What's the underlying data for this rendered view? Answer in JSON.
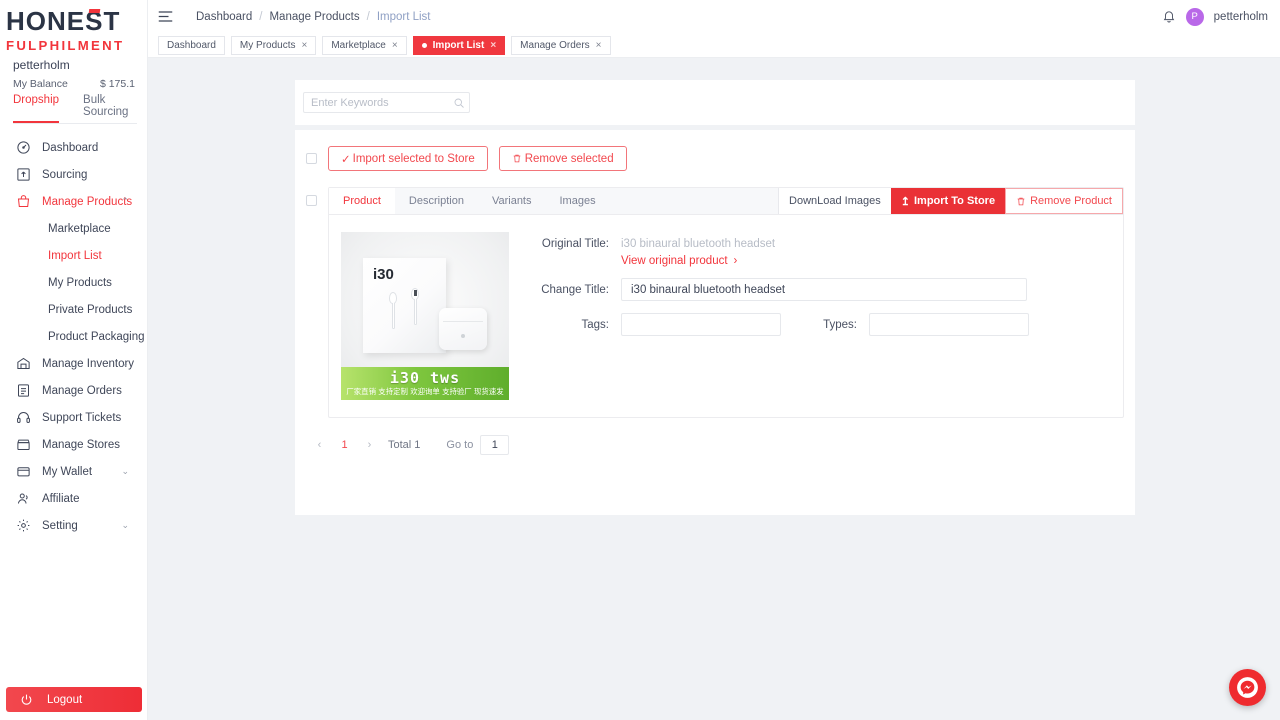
{
  "brand": {
    "logo_top": "HONEST",
    "logo_bottom": "FULPHILMENT",
    "accent_red": "#f2353c",
    "navy": "#2b3445"
  },
  "sidebar": {
    "username": "petterholm",
    "balance_label": "My Balance",
    "balance_value": "$ 175.1",
    "mode_tabs": [
      {
        "label": "Dropship",
        "active": true
      },
      {
        "label": "Bulk Sourcing",
        "active": false
      }
    ],
    "nav": [
      {
        "label": "Dashboard",
        "icon": "speedometer-icon",
        "active": false,
        "expandable": false
      },
      {
        "label": "Sourcing",
        "icon": "sourcing-icon",
        "active": false,
        "expandable": false
      },
      {
        "label": "Manage Products",
        "icon": "bag-icon",
        "active": true,
        "expandable": true,
        "caret": "⌃"
      },
      {
        "label": "Manage Inventory",
        "icon": "warehouse-icon",
        "active": false,
        "expandable": true,
        "caret": "⌄"
      },
      {
        "label": "Manage Orders",
        "icon": "orders-icon",
        "active": false,
        "expandable": false
      },
      {
        "label": "Support Tickets",
        "icon": "headset-icon",
        "active": false,
        "expandable": false
      },
      {
        "label": "Manage Stores",
        "icon": "store-icon",
        "active": false,
        "expandable": false
      },
      {
        "label": "My Wallet",
        "icon": "wallet-icon",
        "active": false,
        "expandable": true,
        "caret": "⌄"
      },
      {
        "label": "Affiliate",
        "icon": "people-icon",
        "active": false,
        "expandable": false
      },
      {
        "label": "Setting",
        "icon": "gear-icon",
        "active": false,
        "expandable": true,
        "caret": "⌄"
      }
    ],
    "sub_items": [
      {
        "label": "Marketplace",
        "active": false
      },
      {
        "label": "Import List",
        "active": true
      },
      {
        "label": "My Products",
        "active": false
      },
      {
        "label": "Private Products",
        "active": false
      },
      {
        "label": "Product Packaging",
        "active": false
      }
    ],
    "logout_label": "Logout"
  },
  "topbar": {
    "menu_icon": "hamburger-icon",
    "breadcrumbs": [
      {
        "label": "Dashboard",
        "current": false
      },
      {
        "label": "Manage Products",
        "current": false
      },
      {
        "label": "Import List",
        "current": true
      }
    ],
    "separator": "/",
    "notification_icon": "bell-icon",
    "avatar_initial": "P",
    "avatar_color": "#b968e8",
    "username": "petterholm"
  },
  "view_tabs": [
    {
      "label": "Dashboard",
      "active": false,
      "closable": false
    },
    {
      "label": "My Products",
      "active": false,
      "closable": true
    },
    {
      "label": "Marketplace",
      "active": false,
      "closable": true
    },
    {
      "label": "Import List",
      "active": true,
      "closable": true
    },
    {
      "label": "Manage Orders",
      "active": false,
      "closable": true
    }
  ],
  "search": {
    "placeholder": "Enter Keywords",
    "value": "",
    "icon": "search-icon"
  },
  "bulk_actions": {
    "import_label": "Import selected to Store",
    "import_icon": "✓",
    "remove_label": "Remove selected",
    "remove_icon": "🗑"
  },
  "product_card": {
    "tabs": [
      {
        "label": "Product",
        "active": true
      },
      {
        "label": "Description",
        "active": false
      },
      {
        "label": "Variants",
        "active": false
      },
      {
        "label": "Images",
        "active": false
      }
    ],
    "actions": [
      {
        "label": "DownLoad Images",
        "style": "plain",
        "icon": ""
      },
      {
        "label": "Import To Store",
        "style": "solid-red",
        "icon": "↥"
      },
      {
        "label": "Remove Product",
        "style": "outline-red",
        "icon": "🗑"
      }
    ],
    "image": {
      "package_label": "i30",
      "banner_title": "i30 tws",
      "banner_subtitle": "厂家直销 支持定制 欢迎询单 支持验厂 现货速发",
      "banner_color": "#7ec63e"
    },
    "fields": {
      "original_title_label": "Original Title:",
      "original_title_value": "i30 binaural bluetooth headset",
      "view_original_label": "View original product",
      "view_original_chevron": "›",
      "change_title_label": "Change Title:",
      "change_title_value": "i30 binaural bluetooth headset",
      "tags_label": "Tags:",
      "tags_value": "",
      "types_label": "Types:",
      "types_value": ""
    }
  },
  "pagination": {
    "prev": "‹",
    "next": "›",
    "current_page": "1",
    "total_label": "Total 1",
    "goto_label": "Go to",
    "goto_value": "1"
  },
  "messenger": {
    "icon": "messenger-icon",
    "color": "#ef2b2f"
  }
}
